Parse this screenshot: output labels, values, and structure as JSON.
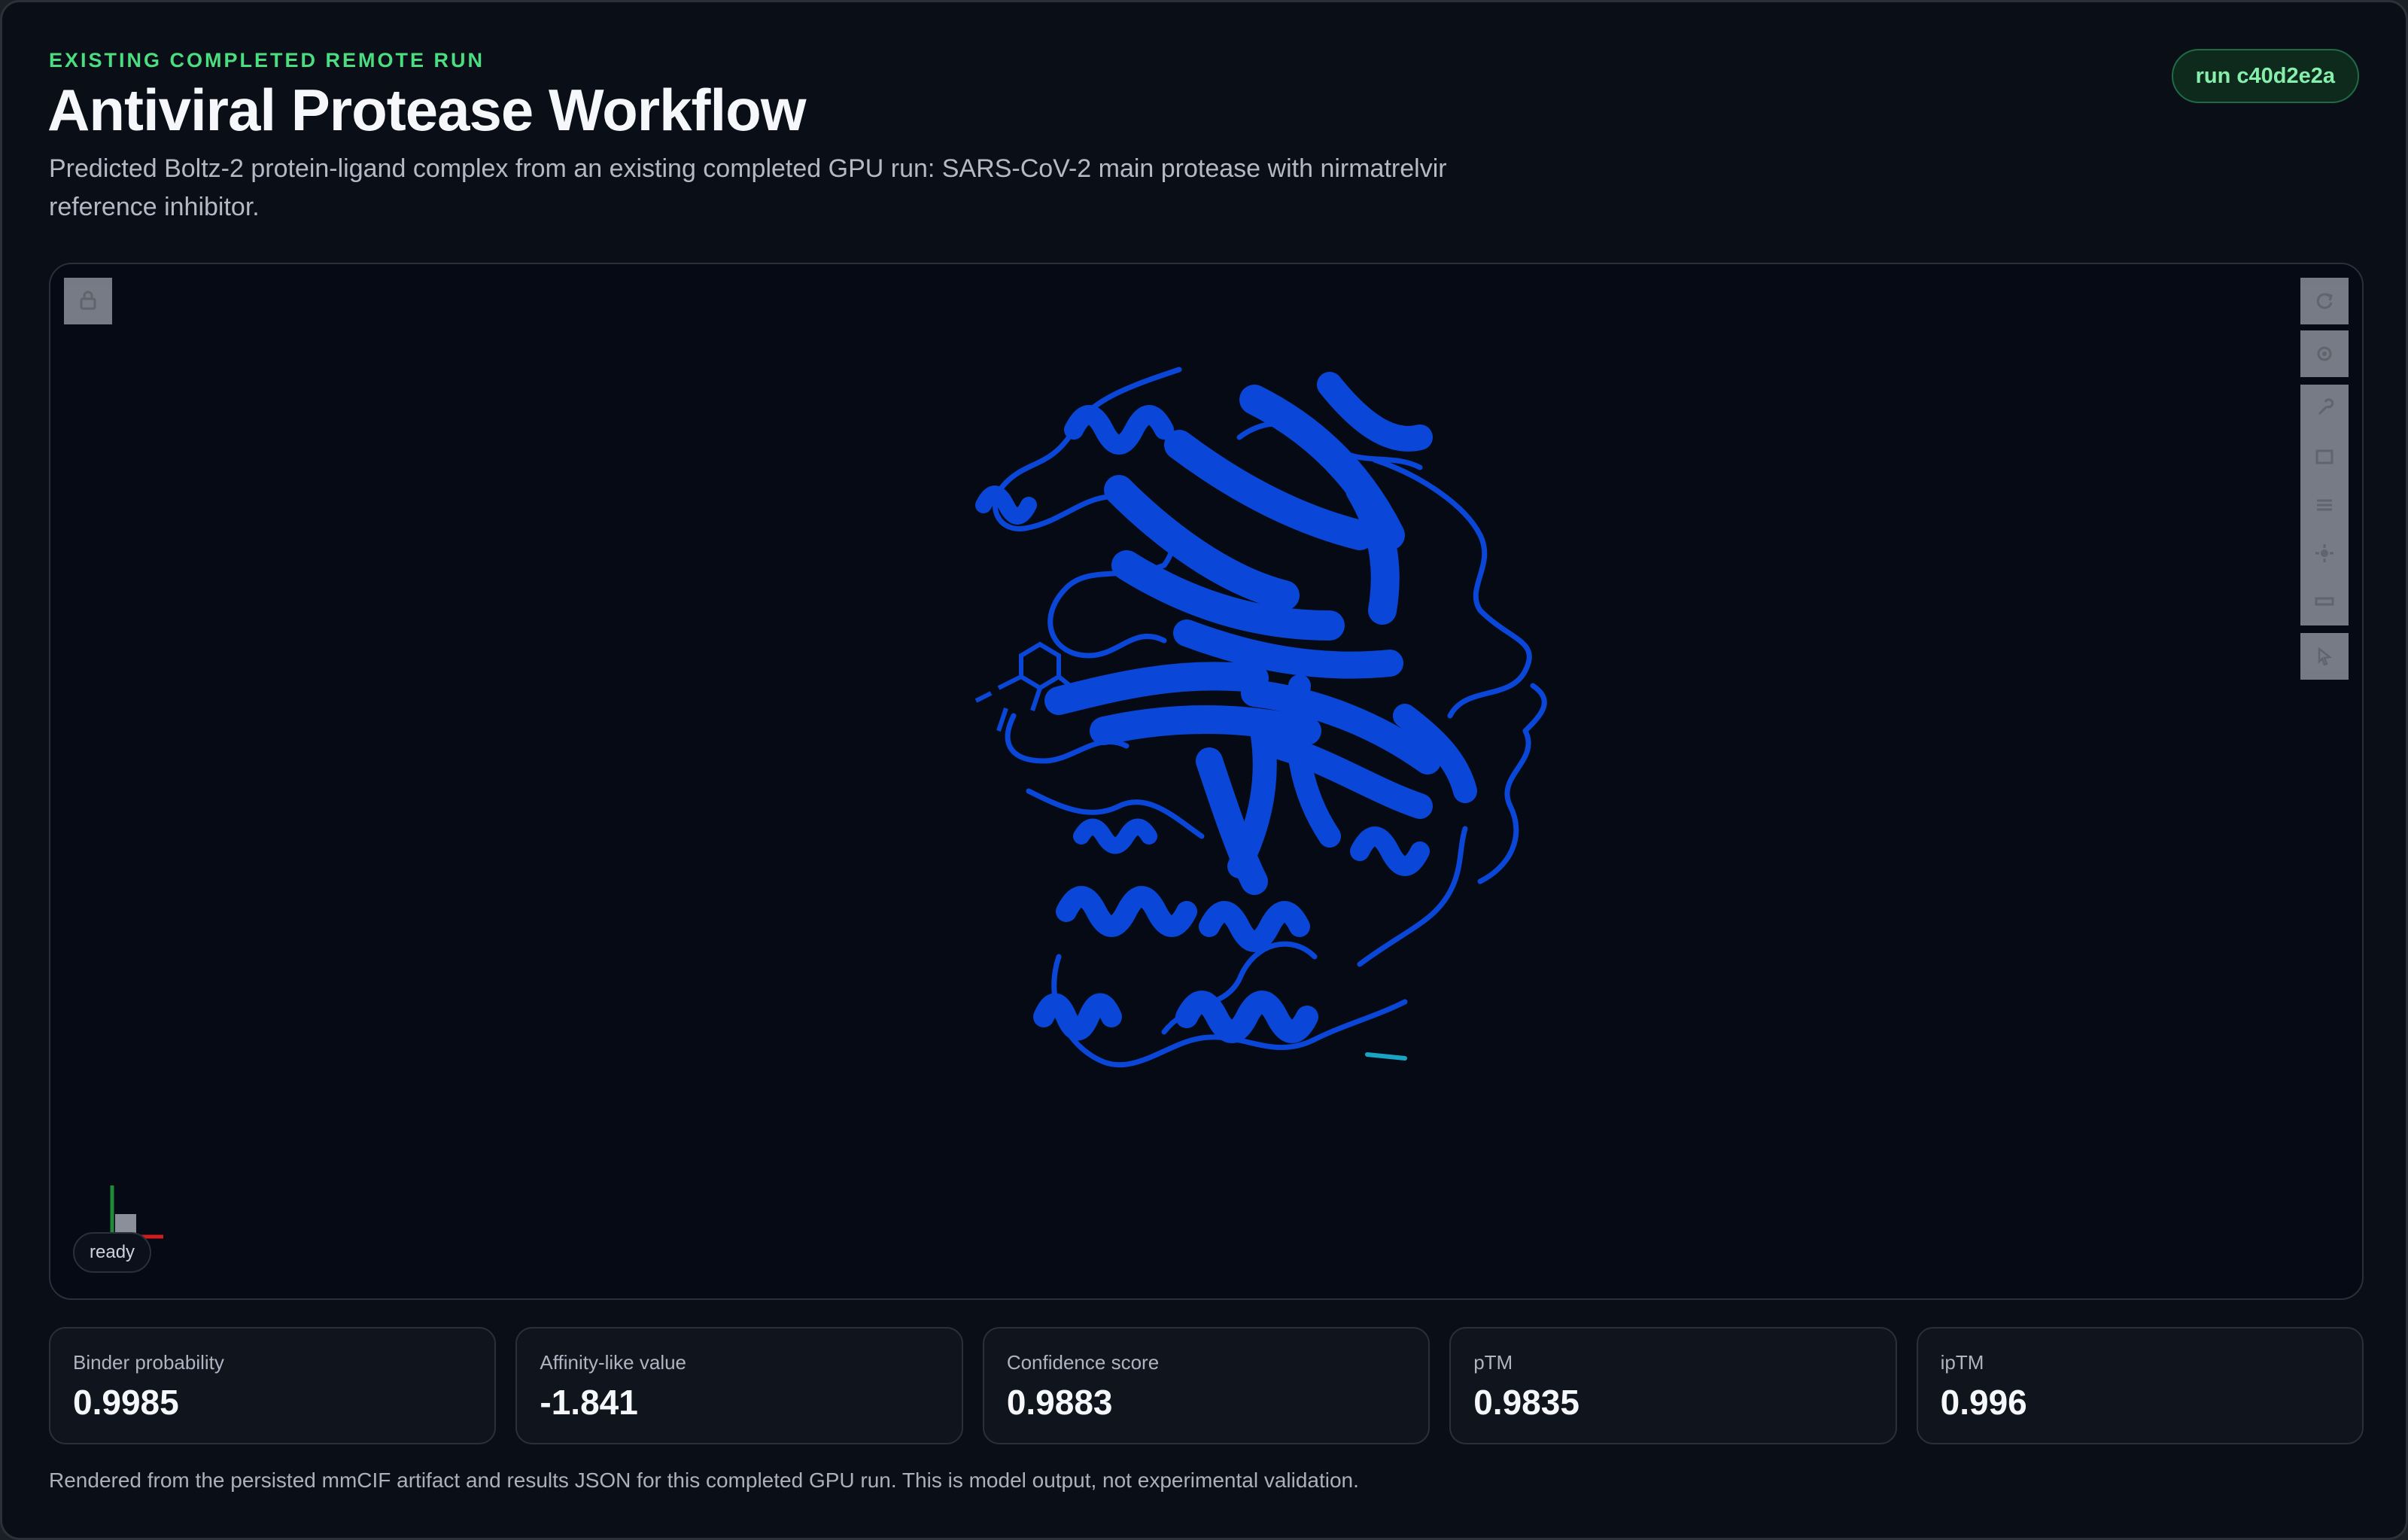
{
  "header": {
    "eyebrow": "EXISTING COMPLETED REMOTE RUN",
    "title": "Antiviral Protease Workflow",
    "subtitle": "Predicted Boltz-2 protein-ligand complex from an existing completed GPU run: SARS-CoV-2 main protease with nirmatrelvir reference inhibitor.",
    "run_badge": "run c40d2e2a"
  },
  "viewer": {
    "status": "ready",
    "structure_color": "#0a47d8",
    "ligand_color": "#1aa3c4",
    "toolbar": [
      {
        "icon": "reset-rotate-icon"
      },
      {
        "icon": "camera-icon"
      },
      {
        "icon": "wrench-icon"
      },
      {
        "icon": "expand-icon"
      },
      {
        "icon": "settings-sliders-icon"
      },
      {
        "icon": "light-icon"
      },
      {
        "icon": "ruler-icon"
      },
      {
        "icon": "pointer-select-icon"
      }
    ],
    "left_toolbar_icon": "toggle-controls-icon"
  },
  "metrics": [
    {
      "label": "Binder probability",
      "value": "0.9985"
    },
    {
      "label": "Affinity-like value",
      "value": "-1.841"
    },
    {
      "label": "Confidence score",
      "value": "0.9883"
    },
    {
      "label": "pTM",
      "value": "0.9835"
    },
    {
      "label": "ipTM",
      "value": "0.996"
    }
  ],
  "footnote": "Rendered from the persisted mmCIF artifact and results JSON for this completed GPU run. This is model output, not experimental validation."
}
